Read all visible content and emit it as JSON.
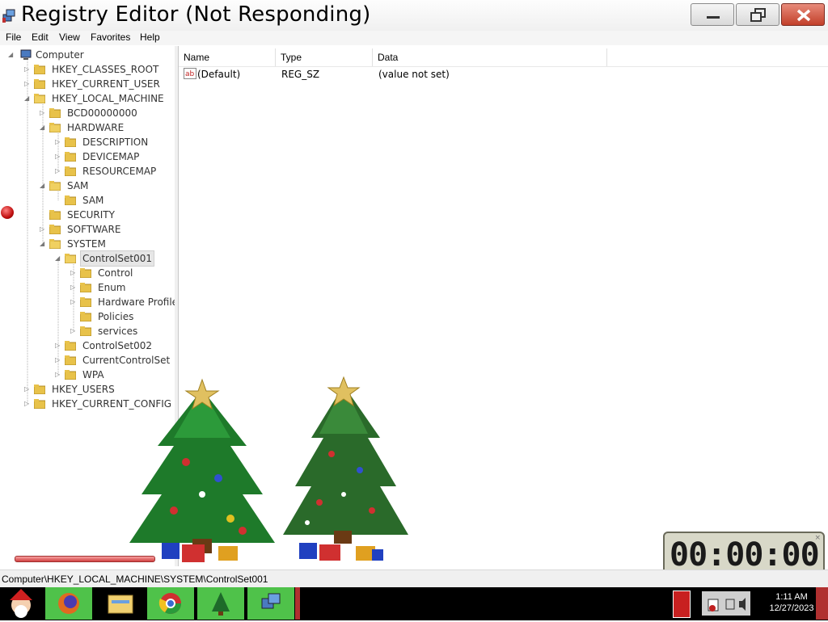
{
  "window": {
    "title": "Registry Editor (Not Responding)"
  },
  "menu": [
    "File",
    "Edit",
    "View",
    "Favorites",
    "Help"
  ],
  "tree": [
    {
      "label": "Computer"
    },
    {
      "label": "HKEY_CLASSES_ROOT"
    },
    {
      "label": "HKEY_CURRENT_USER"
    },
    {
      "label": "HKEY_LOCAL_MACHINE"
    },
    {
      "label": "BCD00000000"
    },
    {
      "label": "HARDWARE"
    },
    {
      "label": "DESCRIPTION"
    },
    {
      "label": "DEVICEMAP"
    },
    {
      "label": "RESOURCEMAP"
    },
    {
      "label": "SAM"
    },
    {
      "label": "SAM"
    },
    {
      "label": "SECURITY"
    },
    {
      "label": "SOFTWARE"
    },
    {
      "label": "SYSTEM"
    },
    {
      "label": "ControlSet001"
    },
    {
      "label": "Control"
    },
    {
      "label": "Enum"
    },
    {
      "label": "Hardware Profiles"
    },
    {
      "label": "Policies"
    },
    {
      "label": "services"
    },
    {
      "label": "ControlSet002"
    },
    {
      "label": "CurrentControlSet"
    },
    {
      "label": "WPA"
    },
    {
      "label": "HKEY_USERS"
    },
    {
      "label": "HKEY_CURRENT_CONFIG"
    }
  ],
  "list": {
    "headers": [
      "Name",
      "Type",
      "Data"
    ],
    "rows": [
      {
        "name": "(Default)",
        "type": "REG_SZ",
        "data": "(value not set)"
      }
    ]
  },
  "status": {
    "path": "Computer\\HKEY_LOCAL_MACHINE\\SYSTEM\\ControlSet001"
  },
  "timer": {
    "display": "00:00:00"
  },
  "taskbar": {
    "items": [
      "santa-icon",
      "firefox-icon",
      "file-explorer-icon",
      "chrome-icon",
      "christmas-tree-app-icon",
      "registry-editor-icon"
    ],
    "clock_time": "1:11 AM",
    "clock_date": "12/27/2023"
  },
  "colors": {
    "taskbar_button_green": "#4fc24a",
    "close_red": "#c2402a"
  }
}
